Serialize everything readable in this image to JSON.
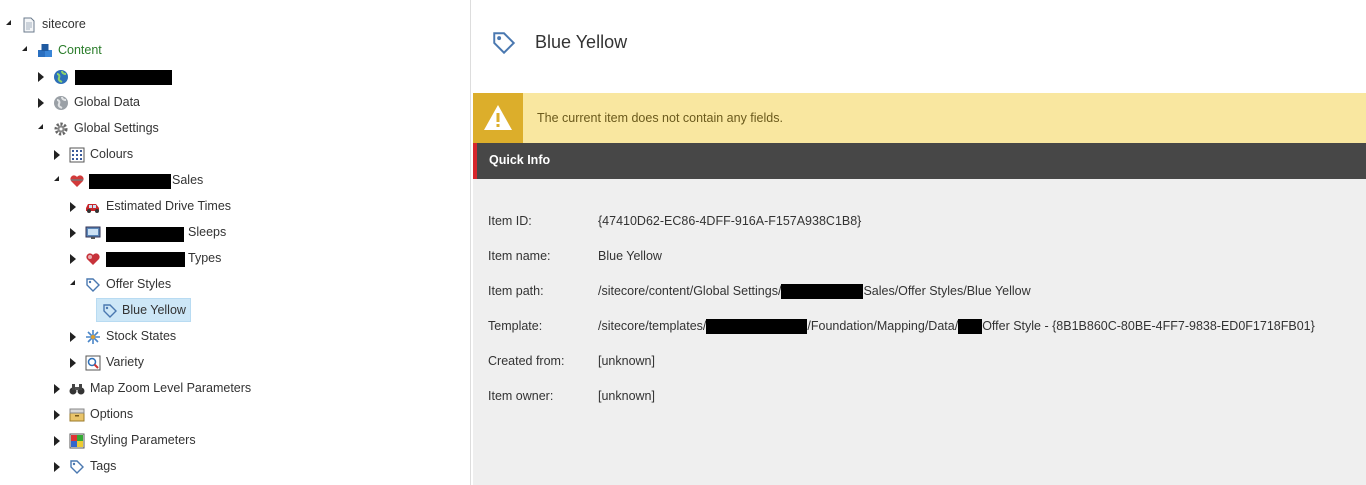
{
  "tree": {
    "root": "sitecore",
    "content": "Content",
    "global_data": "Global Data",
    "global_settings": "Global Settings",
    "colours": "Colours",
    "sales_suffix": "Sales",
    "estimated_drive_times": "Estimated Drive Times",
    "sleeps_suffix": "Sleeps",
    "types_suffix": "Types",
    "offer_styles": "Offer Styles",
    "blue_yellow": "Blue Yellow",
    "stock_states": "Stock States",
    "variety": "Variety",
    "map_zoom": "Map Zoom Level Parameters",
    "options": "Options",
    "styling_parameters": "Styling Parameters",
    "tags": "Tags"
  },
  "detail": {
    "title": "Blue Yellow",
    "warning": "The current item does not contain any fields.",
    "quick_info_title": "Quick Info",
    "rows": {
      "item_id_label": "Item ID:",
      "item_id_value": "{47410D62-EC86-4DFF-916A-F157A938C1B8}",
      "item_name_label": "Item name:",
      "item_name_value": "Blue Yellow",
      "item_path_label": "Item path:",
      "item_path_prefix": "/sitecore/content/Global Settings/",
      "item_path_suffix": "Sales/Offer Styles/Blue Yellow",
      "template_label": "Template:",
      "template_prefix": "/sitecore/templates/",
      "template_middle": "/Foundation/Mapping/Data/",
      "template_suffix": "Offer Style - {8B1B860C-80BE-4FF7-9838-ED0F1718FB01}",
      "created_from_label": "Created from:",
      "created_from_value": "[unknown]",
      "item_owner_label": "Item owner:",
      "item_owner_value": "[unknown]"
    }
  }
}
